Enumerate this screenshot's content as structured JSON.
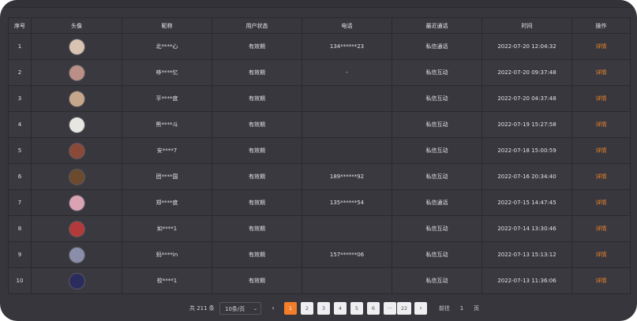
{
  "table": {
    "headers": [
      "序号",
      "头像",
      "昵称",
      "用户状态",
      "电话",
      "最近通话",
      "时间",
      "操作"
    ],
    "rows": [
      {
        "index": "1",
        "avatar_color": "#d8c3b3",
        "nickname": "北****心",
        "status": "有效期",
        "phone": "134******23",
        "last_call": "私信通话",
        "time": "2022-07-20 12:04:32",
        "action": "详情"
      },
      {
        "index": "2",
        "avatar_color": "#b98f86",
        "nickname": "哆****忆",
        "status": "有效期",
        "phone": "-",
        "last_call": "私信互动",
        "time": "2022-07-20 09:37:48",
        "action": "详情"
      },
      {
        "index": "3",
        "avatar_color": "#c7a78c",
        "nickname": "平****度",
        "status": "有效期",
        "phone": "",
        "last_call": "私信互动",
        "time": "2022-07-20 04:37:48",
        "action": "详情"
      },
      {
        "index": "4",
        "avatar_color": "#e8e6e0",
        "nickname": "熊****斗",
        "status": "有效期",
        "phone": "",
        "last_call": "私信互动",
        "time": "2022-07-19 15:27:58",
        "action": "详情"
      },
      {
        "index": "5",
        "avatar_color": "#8a4a3a",
        "nickname": "安****7",
        "status": "有效期",
        "phone": "",
        "last_call": "私信互动",
        "time": "2022-07-18 15:00:59",
        "action": "详情"
      },
      {
        "index": "6",
        "avatar_color": "#6b4a2e",
        "nickname": "团****国",
        "status": "有效期",
        "phone": "189******92",
        "last_call": "私信互动",
        "time": "2022-07-16 20:34:40",
        "action": "详情"
      },
      {
        "index": "7",
        "avatar_color": "#d9a3b4",
        "nickname": "郑****度",
        "status": "有效期",
        "phone": "135******54",
        "last_call": "私信通话",
        "time": "2022-07-15 14:47:45",
        "action": "详情"
      },
      {
        "index": "8",
        "avatar_color": "#b33a3a",
        "nickname": "如****1",
        "status": "有效期",
        "phone": "",
        "last_call": "私信互动",
        "time": "2022-07-14 13:30:46",
        "action": "详情"
      },
      {
        "index": "9",
        "avatar_color": "#8a8ea8",
        "nickname": "蚂****in",
        "status": "有效期",
        "phone": "157******06",
        "last_call": "私信互动",
        "time": "2022-07-13 15:13:12",
        "action": "详情"
      },
      {
        "index": "10",
        "avatar_color": "#2a2c5e",
        "nickname": "校****1",
        "status": "有效期",
        "phone": "",
        "last_call": "私信互动",
        "time": "2022-07-13 11:36:06",
        "action": "详情"
      }
    ]
  },
  "pagination": {
    "total": "共 211 条",
    "page_size": "10条/页",
    "prev": "‹",
    "pages": [
      "1",
      "2",
      "3",
      "4",
      "5",
      "6",
      "···",
      "22"
    ],
    "next": "›",
    "goto_label": "前往",
    "goto_value": "1",
    "goto_suffix": "页"
  },
  "colors": {
    "accent": "#f37d2b",
    "background": "#37363c",
    "action_text": "#f0842c"
  },
  "icons": {
    "page_size_dropdown": "chevron-down-icon",
    "prev": "chevron-left-icon",
    "next": "chevron-right-icon"
  }
}
